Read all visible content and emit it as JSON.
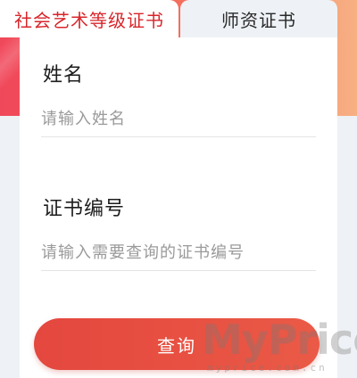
{
  "tabs": [
    {
      "label": "社会艺术等级证书",
      "active": true
    },
    {
      "label": "师资证书",
      "active": false
    }
  ],
  "form": {
    "name_label": "姓名",
    "name_placeholder": "请输入姓名",
    "cert_label": "证书编号",
    "cert_placeholder": "请输入需要查询的证书编号"
  },
  "button": {
    "label": "查询"
  },
  "watermark": {
    "title": "MyPrice",
    "url": "myprice.com.cn"
  },
  "colors": {
    "accent": "#d8252b",
    "button": "#e64a40",
    "band_start": "#f0485b",
    "band_end": "#f7b083"
  }
}
